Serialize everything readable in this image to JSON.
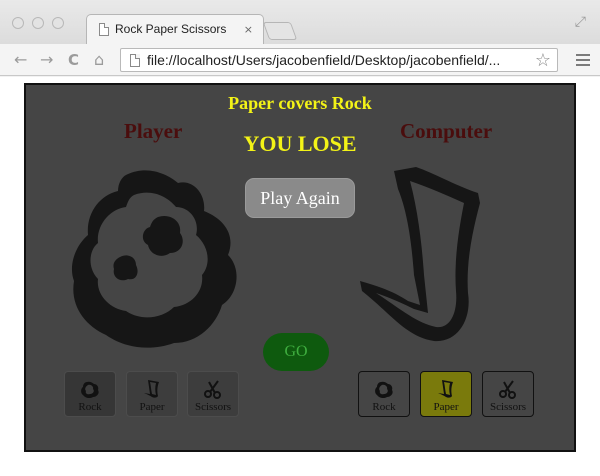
{
  "browser": {
    "tab_title": "Rock Paper Scissors",
    "tab_close": "×",
    "url": "file://localhost/Users/jacobenfield/Desktop/jacobenfield/...",
    "back_icon": "←",
    "forward_icon": "→",
    "reload_icon": "C",
    "home_icon": "⌂",
    "star_icon": "☆"
  },
  "game": {
    "outcome_message": "Paper covers Rock",
    "result": "YOU LOSE",
    "player_title": "Player",
    "computer_title": "Computer",
    "play_again_label": "Play Again",
    "go_label": "GO",
    "player_choices": [
      {
        "label": "Rock",
        "icon": "rock-icon",
        "selected": true
      },
      {
        "label": "Paper",
        "icon": "paper-icon",
        "selected": false
      },
      {
        "label": "Scissors",
        "icon": "scissors-icon",
        "selected": false
      }
    ],
    "computer_choices": [
      {
        "label": "Rock",
        "icon": "rock-icon",
        "selected": false
      },
      {
        "label": "Paper",
        "icon": "paper-icon",
        "selected": true
      },
      {
        "label": "Scissors",
        "icon": "scissors-icon",
        "selected": false
      }
    ],
    "player_display": "rock",
    "computer_display": "paper",
    "colors": {
      "message": "#f3f317",
      "side_title": "#4a0d0d",
      "go_button": "#0e5a0e",
      "computer_selected": "#7a7a0c"
    }
  }
}
